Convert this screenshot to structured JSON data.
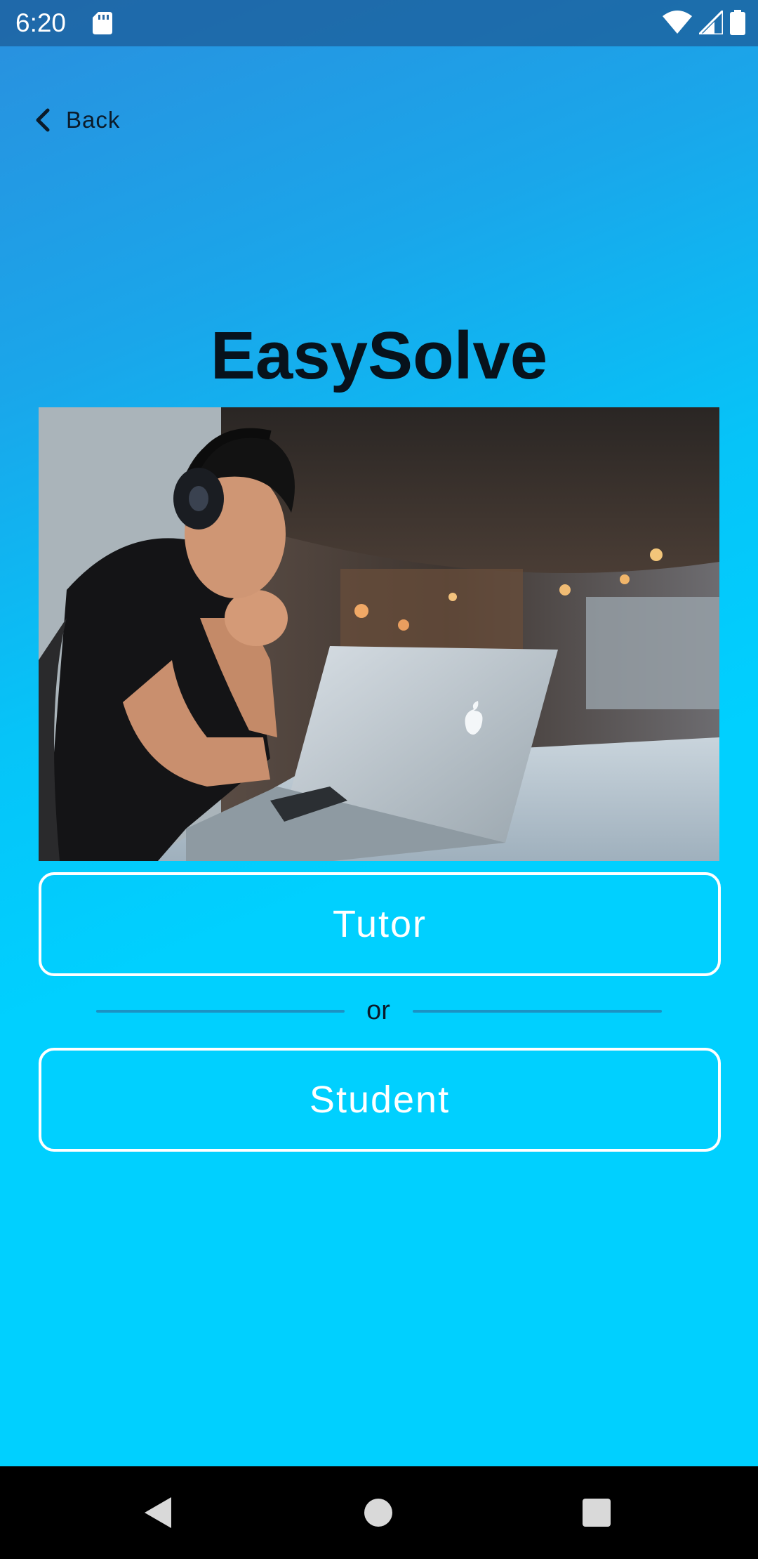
{
  "status_bar": {
    "time": "6:20",
    "icons": [
      "sd-card-icon",
      "wifi-icon",
      "cellular-signal-icon",
      "battery-icon"
    ]
  },
  "header": {
    "back_label": "Back",
    "back_icon": "chevron-left-icon"
  },
  "main": {
    "title": "EasySolve",
    "hero_image": "man-with-headphones-at-laptop-photo",
    "tutor_label": "Tutor",
    "divider_text": "or",
    "student_label": "Student"
  },
  "nav_bar": {
    "icons": [
      "nav-back-icon",
      "nav-home-icon",
      "nav-recents-icon"
    ]
  },
  "colors": {
    "gradient_start": "#2a8fde",
    "gradient_end": "#00d0ff",
    "button_border": "#ffffff",
    "divider": "#1b92c4",
    "title_text": "#07121c"
  }
}
